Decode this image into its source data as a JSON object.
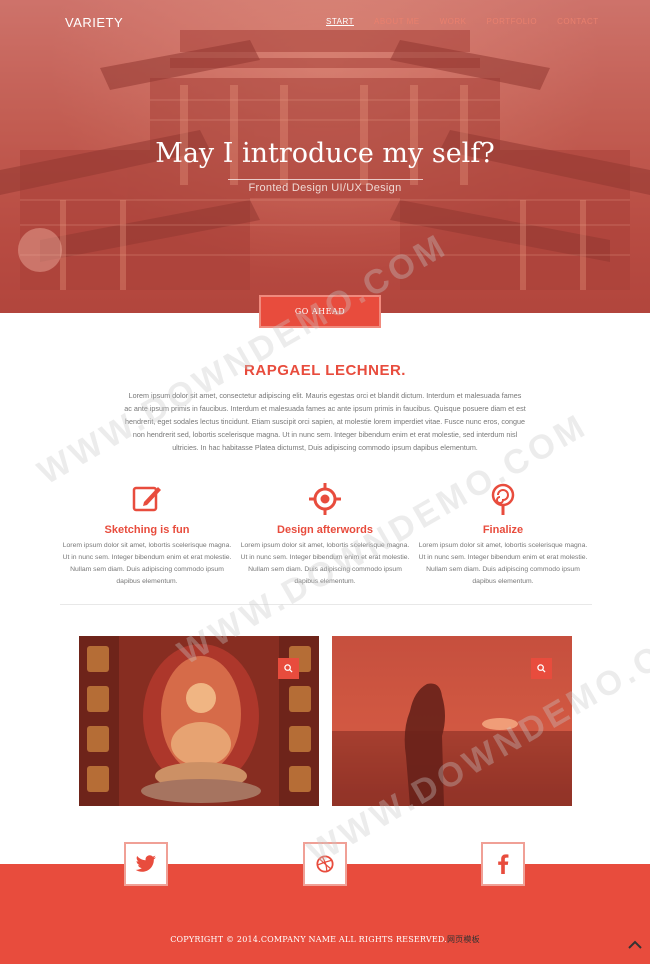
{
  "brand": "VARIETY",
  "nav": [
    {
      "label": "START",
      "active": true
    },
    {
      "label": "ABOUT ME",
      "active": false
    },
    {
      "label": "WORK",
      "active": false
    },
    {
      "label": "PORTFOLIO",
      "active": false
    },
    {
      "label": "CONTACT",
      "active": false
    }
  ],
  "hero": {
    "title": "May I introduce my self?",
    "subtitle": "Fronted Design UI/UX Design",
    "button": "GO AHEAD"
  },
  "about": {
    "name": "RAPGAEL LECHNER.",
    "text": "Lorem ipsum dolor sit amet, consectetur adipiscing elit. Mauris egestas orci et blandit dictum. Interdum et malesuada fames ac ante ipsum primis in faucibus. Interdum et malesuada fames ac ante ipsum primis in faucibus. Quisque posuere diam et est hendrerit, eget sodales lectus tincidunt. Etiam suscipit orci sapien, at molestie lorem imperdiet vitae. Fusce nunc eros, congue non hendrerit sed, lobortis scelerisque magna. Ut in nunc sem. Integer bibendum enim et erat molestie, sed interdum nisl ultricies. In hac habitasse Platea dictumst, Duis adipiscing commodo ipsum dapibus elementum."
  },
  "features": [
    {
      "icon": "edit-icon",
      "title": "Sketching is fun",
      "text": "Lorem ipsum dolor sit amet, lobortis scelerisque magna. Ut in nunc sem. Integer bibendum enim et erat molestie. Nullam sem diam. Duis adipiscing commodo ipsum dapibus elementum."
    },
    {
      "icon": "target-icon",
      "title": "Design afterwords",
      "text": "Lorem ipsum dolor sit amet, lobortis scelerisque magna. Ut in nunc sem. Integer bibendum enim et erat molestie. Nullam sem diam. Duis adipiscing commodo ipsum dapibus elementum."
    },
    {
      "icon": "lollipop-icon",
      "title": "Finalize",
      "text": "Lorem ipsum dolor sit amet, lobortis scelerisque magna. Ut in nunc sem. Integer bibendum enim et erat molestie. Nullam sem diam. Duis adipiscing commodo ipsum dapibus elementum."
    }
  ],
  "gallery": [
    {
      "icon": "search-icon"
    },
    {
      "icon": "search-icon"
    }
  ],
  "social": [
    {
      "icon": "twitter-icon"
    },
    {
      "icon": "dribbble-icon"
    },
    {
      "icon": "facebook-icon"
    }
  ],
  "footer": {
    "copyright": "COPYRIGHT © 2014.COMPANY NAME ALL RIGHTS RESERVED.",
    "copyright_cn": "网页模板"
  },
  "watermark": "WWW.DOWNDEMO.COM",
  "colors": {
    "accent": "#e84c3d",
    "text": "#777777"
  }
}
